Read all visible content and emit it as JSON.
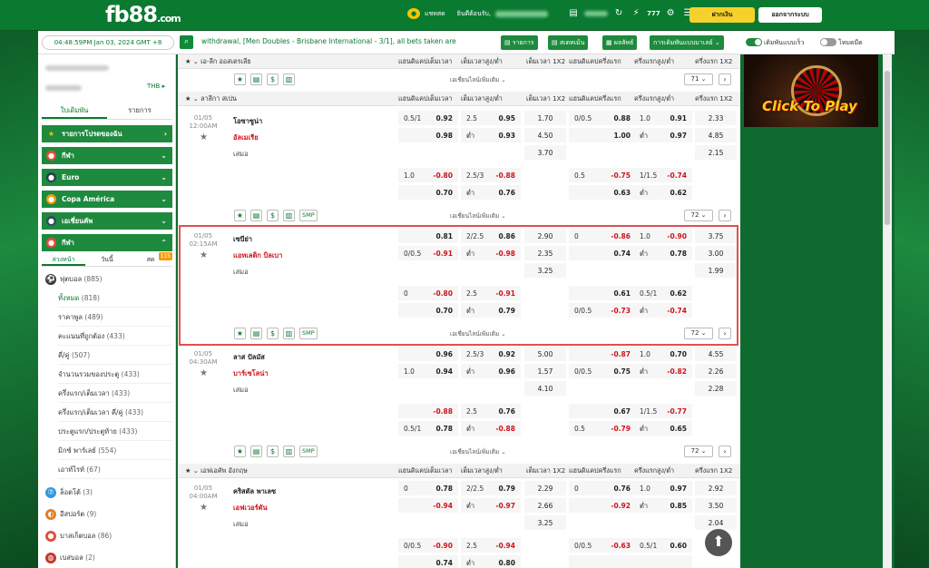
{
  "header": {
    "logo_main": "fb88",
    "logo_suffix": ".com",
    "chat_label": "แชทสด",
    "welcome_label": "ยินดีต้อนรับ,",
    "balance": "฿1.88",
    "deposit_label": "ฝากเงิน",
    "logout_label": "ออกจากระบบ"
  },
  "toolbar": {
    "clock": "04:48:59PM Jan 03, 2024 GMT +8",
    "ticker": "withdrawal, [Men Doubles - Brisbane International - 3/1], all bets taken are",
    "list_btn": "รายการ",
    "statement_btn": "สเตทเม้น",
    "results_btn": "ผลลัพธ์",
    "settings_btn": "การเดิมพันแบบมาเลย์ ⌄",
    "quick_bet": "เดิมพันแบบเร็ว",
    "dark_mode": "โหมดมืด"
  },
  "sidebar": {
    "balance_value": "THB ▸",
    "tab_betslip": "ใบเดิมพัน",
    "tab_list": "รายการ",
    "sections": [
      {
        "label": "รายการโปรดของฉัน"
      },
      {
        "label": "กีฬา"
      },
      {
        "label": "Euro"
      },
      {
        "label": "Copa América"
      },
      {
        "label": "เอเชี่ยนคัพ"
      },
      {
        "label": "กีฬา"
      }
    ],
    "subtabs": [
      "ล่วงหน้า",
      "วันนี้",
      "สด"
    ],
    "live_count": "115",
    "football": "ฟุตบอล",
    "football_count": "(885)",
    "subitems": [
      {
        "label": "ทั้งหมด",
        "count": "(818)"
      },
      {
        "label": "ราคาพูล",
        "count": "(489)"
      },
      {
        "label": "คะแนนที่ถูกต้อง",
        "count": "(433)"
      },
      {
        "label": "คี่/คู่",
        "count": "(507)"
      },
      {
        "label": "จำนวนรวมของประตู",
        "count": "(433)"
      },
      {
        "label": "ครึ่งแรก/เต็มเวลา",
        "count": "(433)"
      },
      {
        "label": "ครึ่งแรก/เต็มเวลา คี่/คู่",
        "count": "(433)"
      },
      {
        "label": "ประตูแรก/ประตูท้าย",
        "count": "(433)"
      },
      {
        "label": "มิกซ์ พาร์เลย์",
        "count": "(554)"
      },
      {
        "label": "เอาท์ไรท์",
        "count": "(67)"
      }
    ],
    "other_sports": [
      {
        "label": "ล็อตโต้",
        "count": "(3)"
      },
      {
        "label": "อีสปอร์ต",
        "count": "(9)"
      },
      {
        "label": "บาสเก็ตบอล",
        "count": "(86)"
      },
      {
        "label": "เบสบอล",
        "count": "(2)"
      }
    ]
  },
  "columns": [
    "แฮนดิแคปเต็มเวลา",
    "เต็มเวลาสูง/ต่ำ",
    "เต็มเวลา 1X2",
    "แฮนดิแคปครึ่งแรก",
    "ครึ่งแรกสูง/ต่ำ",
    "ครึ่งแรก 1X2"
  ],
  "more_bets": "เอเชี่ยนไลน์เพิ่มเติม ⌄",
  "low_label": "ต่ำ",
  "smp": "SMP",
  "leagues": {
    "ligue1": {
      "name": "เอ-ลีก ออสเตรเลีย",
      "more_count": "71 ⌄"
    },
    "laliga": {
      "name": "ลาลีกา สเปน"
    },
    "epl": {
      "name": "เอฟเอคัพ อังกฤษ"
    }
  },
  "matches": {
    "m1": {
      "date": "01/05",
      "time": "12:00AM",
      "home": "โอซาซูน่า",
      "away": "อัลเมเรีย",
      "draw": "เสมอ",
      "r1": [
        "0.5/1",
        "0.92",
        "2.5",
        "0.95",
        "1.70",
        "0/0.5",
        "0.88",
        "1.0",
        "0.91",
        "2.33"
      ],
      "r2": [
        "",
        "0.98",
        "ต่ำ",
        "0.93",
        "4.50",
        "",
        "1.00",
        "ต่ำ",
        "0.97",
        "4.85"
      ],
      "r3": [
        "3.70",
        "2.15"
      ],
      "r4": [
        "1.0",
        "-0.80",
        "2.5/3",
        "-0.88",
        "0.5",
        "-0.75",
        "1/1.5",
        "-0.74"
      ],
      "r5": [
        "",
        "0.70",
        "ต่ำ",
        "0.76",
        "",
        "0.63",
        "ต่ำ",
        "0.62"
      ],
      "more_count": "72 ⌄"
    },
    "m2": {
      "date": "01/05",
      "time": "02:15AM",
      "home": "เซบีย่า",
      "away": "แอทเลติก บิลเบา",
      "draw": "เสมอ",
      "r1": [
        "",
        "0.81",
        "2/2.5",
        "0.86",
        "2.90",
        "0",
        "-0.86",
        "1.0",
        "-0.90",
        "3.75"
      ],
      "r2": [
        "0/0.5",
        "-0.91",
        "ต่ำ",
        "-0.98",
        "2.35",
        "",
        "0.74",
        "ต่ำ",
        "0.78",
        "3.00"
      ],
      "r3": [
        "3.25",
        "1.99"
      ],
      "r4": [
        "0",
        "-0.80",
        "2.5",
        "-0.91",
        "",
        "0.61",
        "0.5/1",
        "0.62"
      ],
      "r5": [
        "",
        "0.70",
        "ต่ำ",
        "0.79",
        "0/0.5",
        "-0.73",
        "ต่ำ",
        "-0.74"
      ],
      "more_count": "72 ⌄"
    },
    "m3": {
      "date": "01/05",
      "time": "04:30AM",
      "home": "ลาส ปัลมัส",
      "away": "บาร์เซโลน่า",
      "draw": "เสมอ",
      "r1": [
        "",
        "0.96",
        "2.5/3",
        "0.92",
        "5.00",
        "",
        "-0.87",
        "1.0",
        "0.70",
        "4.55"
      ],
      "r2": [
        "1.0",
        "0.94",
        "ต่ำ",
        "0.96",
        "1.57",
        "0/0.5",
        "0.75",
        "ต่ำ",
        "-0.82",
        "2.26"
      ],
      "r3": [
        "4.10",
        "2.28"
      ],
      "r4": [
        "",
        "-0.88",
        "2.5",
        "0.76",
        "",
        "0.67",
        "1/1.5",
        "-0.77"
      ],
      "r5": [
        "0.5/1",
        "0.78",
        "ต่ำ",
        "-0.88",
        "0.5",
        "-0.79",
        "ต่ำ",
        "0.65"
      ],
      "more_count": "72 ⌄"
    },
    "m4": {
      "date": "01/05",
      "time": "04:00AM",
      "home": "คริสตัล พาเลซ",
      "away": "เอฟเวอร์ตัน",
      "draw": "เสมอ",
      "r1": [
        "0",
        "0.78",
        "2/2.5",
        "0.79",
        "2.29",
        "0",
        "0.76",
        "1.0",
        "0.97",
        "2.92"
      ],
      "r2": [
        "",
        "-0.94",
        "ต่ำ",
        "-0.97",
        "2.66",
        "",
        "-0.92",
        "ต่ำ",
        "0.85",
        "3.50"
      ],
      "r3": [
        "3.25",
        "2.04"
      ],
      "r4": [
        "0/0.5",
        "-0.90",
        "2.5",
        "-0.94",
        "0/0.5",
        "-0.63",
        "0.5/1",
        "0.60"
      ],
      "r5": [
        "",
        "0.74",
        "ต่ำ",
        "0.80",
        "",
        "",
        "",
        ""
      ]
    }
  },
  "ad": {
    "text": "Click To Play"
  }
}
